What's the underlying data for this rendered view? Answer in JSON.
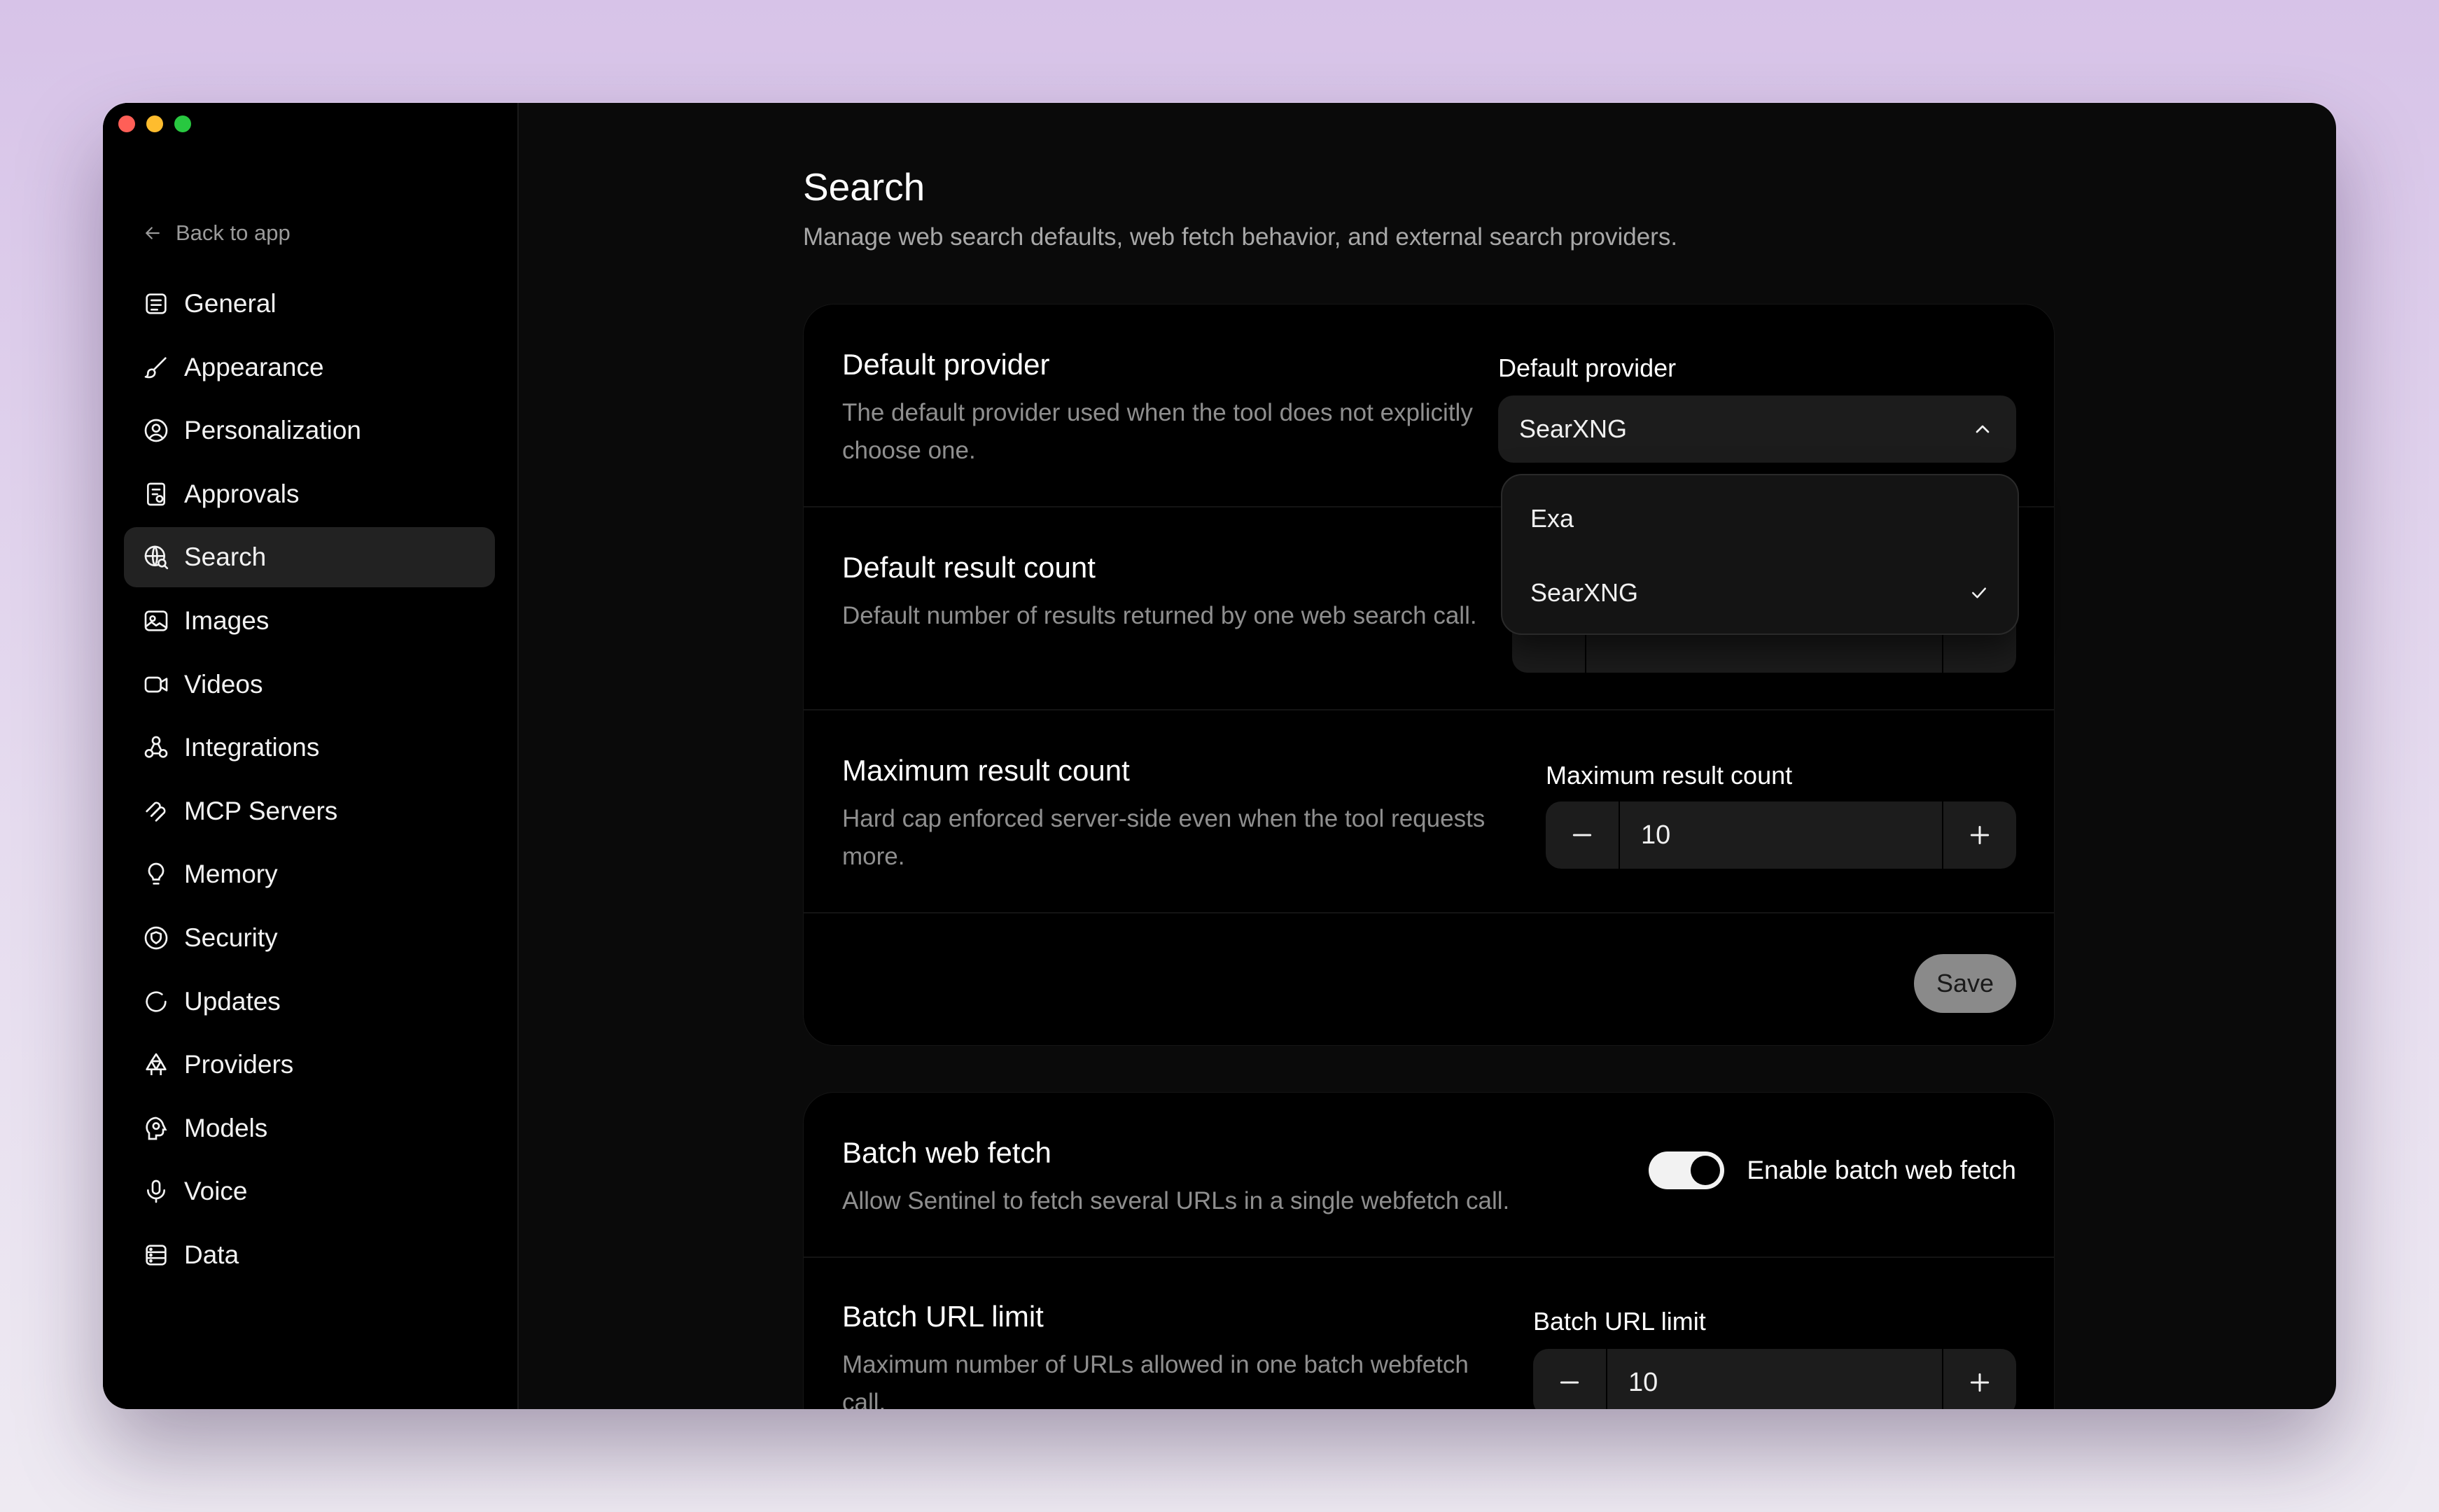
{
  "sidebar": {
    "back_label": "Back to app",
    "items": [
      {
        "label": "General",
        "icon": "general-icon"
      },
      {
        "label": "Appearance",
        "icon": "brush-icon"
      },
      {
        "label": "Personalization",
        "icon": "user-circle-icon"
      },
      {
        "label": "Approvals",
        "icon": "approvals-icon"
      },
      {
        "label": "Search",
        "icon": "globe-search-icon",
        "active": true
      },
      {
        "label": "Images",
        "icon": "image-icon"
      },
      {
        "label": "Videos",
        "icon": "video-icon"
      },
      {
        "label": "Integrations",
        "icon": "integrations-icon"
      },
      {
        "label": "MCP Servers",
        "icon": "mcp-icon"
      },
      {
        "label": "Memory",
        "icon": "lightbulb-icon"
      },
      {
        "label": "Security",
        "icon": "shield-icon"
      },
      {
        "label": "Updates",
        "icon": "refresh-icon"
      },
      {
        "label": "Providers",
        "icon": "providers-icon"
      },
      {
        "label": "Models",
        "icon": "brain-icon"
      },
      {
        "label": "Voice",
        "icon": "microphone-icon"
      },
      {
        "label": "Data",
        "icon": "database-icon"
      }
    ]
  },
  "page": {
    "title": "Search",
    "description": "Manage web search defaults, web fetch behavior, and external search providers."
  },
  "default_provider": {
    "title": "Default provider",
    "description": "The default provider used when the tool does not explicitly choose one.",
    "field_label": "Default provider",
    "selected": "SearXNG",
    "options": [
      {
        "label": "Exa",
        "selected": false
      },
      {
        "label": "SearXNG",
        "selected": true
      }
    ]
  },
  "default_result_count": {
    "title": "Default result count",
    "description": "Default number of results returned by one web search call."
  },
  "max_result_count": {
    "title": "Maximum result count",
    "description": "Hard cap enforced server-side even when the tool requests more.",
    "field_label": "Maximum result count",
    "value": "10"
  },
  "save_label": "Save",
  "batch_web_fetch": {
    "title": "Batch web fetch",
    "description": "Allow Sentinel to fetch several URLs in a single webfetch call.",
    "toggle_label": "Enable batch web fetch",
    "enabled": true
  },
  "batch_url_limit": {
    "title": "Batch URL limit",
    "description": "Maximum number of URLs allowed in one batch webfetch call.",
    "field_label": "Batch URL limit",
    "value": "10"
  },
  "colors": {
    "background": "#0a0a0a",
    "sidebar": "#000000",
    "active_item": "#222222",
    "input": "#1c1c1c"
  }
}
